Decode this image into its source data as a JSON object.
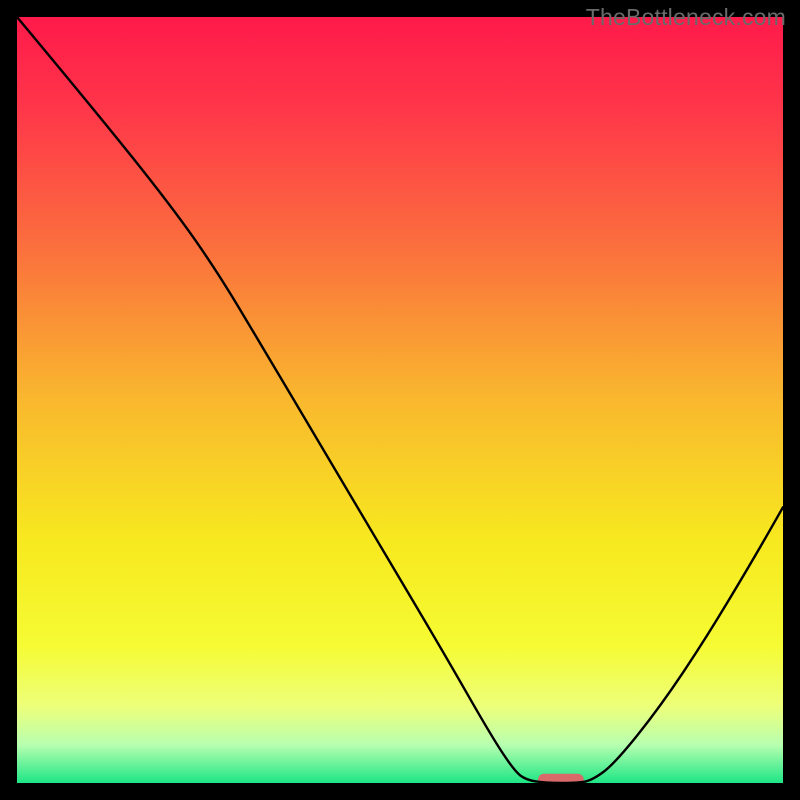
{
  "watermark": "TheBottleneck.com",
  "chart_data": {
    "type": "line",
    "title": "",
    "xlabel": "",
    "ylabel": "",
    "xlim": [
      0,
      100
    ],
    "ylim": [
      0,
      100
    ],
    "background_gradient": {
      "stops": [
        {
          "offset": 0.0,
          "color": "#ff1a4a"
        },
        {
          "offset": 0.12,
          "color": "#ff364a"
        },
        {
          "offset": 0.3,
          "color": "#fb6f3d"
        },
        {
          "offset": 0.5,
          "color": "#f9b82e"
        },
        {
          "offset": 0.68,
          "color": "#f7e81f"
        },
        {
          "offset": 0.82,
          "color": "#f6fb33"
        },
        {
          "offset": 0.9,
          "color": "#edff7a"
        },
        {
          "offset": 0.95,
          "color": "#b8ffb0"
        },
        {
          "offset": 1.0,
          "color": "#1de685"
        }
      ]
    },
    "series": [
      {
        "name": "bottleneck-curve",
        "color": "#000000",
        "width": 2.4,
        "points": [
          {
            "x": 0.0,
            "y": 100.0
          },
          {
            "x": 10.0,
            "y": 88.0
          },
          {
            "x": 20.0,
            "y": 75.5
          },
          {
            "x": 26.0,
            "y": 67.0
          },
          {
            "x": 32.0,
            "y": 57.0
          },
          {
            "x": 40.0,
            "y": 43.5
          },
          {
            "x": 48.0,
            "y": 30.0
          },
          {
            "x": 56.0,
            "y": 16.5
          },
          {
            "x": 62.0,
            "y": 6.0
          },
          {
            "x": 65.0,
            "y": 1.5
          },
          {
            "x": 66.5,
            "y": 0.4
          },
          {
            "x": 69.0,
            "y": 0.0
          },
          {
            "x": 73.0,
            "y": 0.0
          },
          {
            "x": 75.0,
            "y": 0.3
          },
          {
            "x": 78.0,
            "y": 2.5
          },
          {
            "x": 84.0,
            "y": 10.0
          },
          {
            "x": 90.0,
            "y": 19.0
          },
          {
            "x": 96.0,
            "y": 29.0
          },
          {
            "x": 100.0,
            "y": 36.0
          }
        ]
      }
    ],
    "marker": {
      "x": 71.0,
      "y": 0.4,
      "width": 6.0,
      "height": 1.6,
      "color": "#d86a6a"
    }
  }
}
